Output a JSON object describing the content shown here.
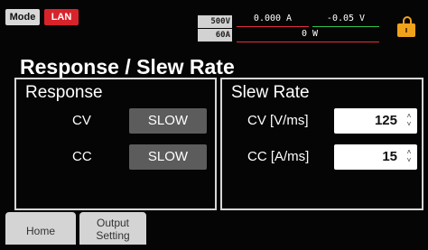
{
  "status": {
    "mode": "Mode",
    "interface": "LAN",
    "voltage_rating": "500V",
    "current_rating": "60A",
    "current_reading": "0.000 A",
    "voltage_reading": "-0.05 V",
    "power_reading": "0 W"
  },
  "page_title": "Response / Slew Rate",
  "response": {
    "title": "Response",
    "cv_label": "CV",
    "cv_value": "SLOW",
    "cc_label": "CC",
    "cc_value": "SLOW"
  },
  "slew_rate": {
    "title": "Slew Rate",
    "cv_label": "CV [V/ms]",
    "cv_value": "125",
    "cc_label": "CC [A/ms]",
    "cc_value": "15"
  },
  "tabs": {
    "home": "Home",
    "output_line1": "Output",
    "output_line2": "Setting"
  },
  "colors": {
    "lan_badge": "#d8232a",
    "underline_current": "#e0303a",
    "underline_voltage": "#2fc24a",
    "lock": "#f0a21a",
    "button": "#5c5c5c"
  },
  "icons": {
    "lock": "unlocked-padlock-icon",
    "spinner": "up-down-chevron-icon"
  }
}
